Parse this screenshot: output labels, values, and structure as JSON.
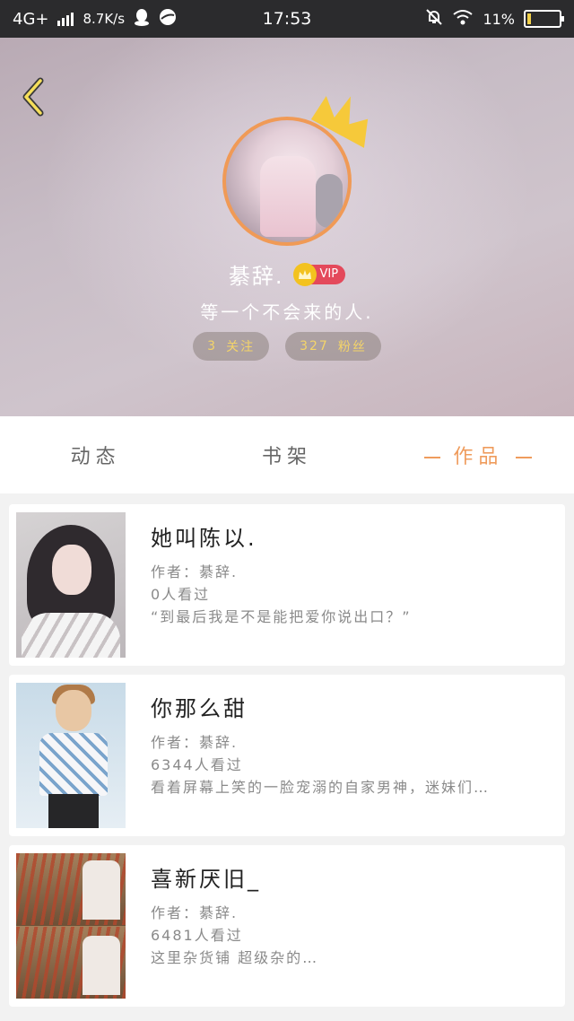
{
  "status_bar": {
    "network": "4G+",
    "speed": "8.7K/s",
    "time": "17:53",
    "battery_text": "11%",
    "battery_level": 0.11
  },
  "profile": {
    "name": "綦辞.",
    "vip_label": "VIP",
    "signature": "等一个不会来的人.",
    "follow_count": "3",
    "follow_label": "关注",
    "fans_count": "327",
    "fans_label": "粉丝"
  },
  "tabs": [
    {
      "label": "动态",
      "active": false
    },
    {
      "label": "书架",
      "active": false
    },
    {
      "label": "作品",
      "active": true
    }
  ],
  "works": [
    {
      "title": "她叫陈以.",
      "author": "作者：綦辞.",
      "views": "0人看过",
      "summary": "“到最后我是不是能把爱你说出口？”"
    },
    {
      "title": "你那么甜",
      "author": "作者：綦辞.",
      "views": "6344人看过",
      "summary": "看着屏幕上笑的一脸宠溺的自家男神，迷妹们…"
    },
    {
      "title": "喜新厌旧_",
      "author": "作者：綦辞.",
      "views": "6481人看过",
      "summary": "这里杂货铺 超级杂的…"
    }
  ],
  "colors": {
    "accent": "#ef9c5d",
    "status_bar": "#2b2b2d",
    "vip": "#e4495b",
    "stat_text": "#f4d469"
  }
}
